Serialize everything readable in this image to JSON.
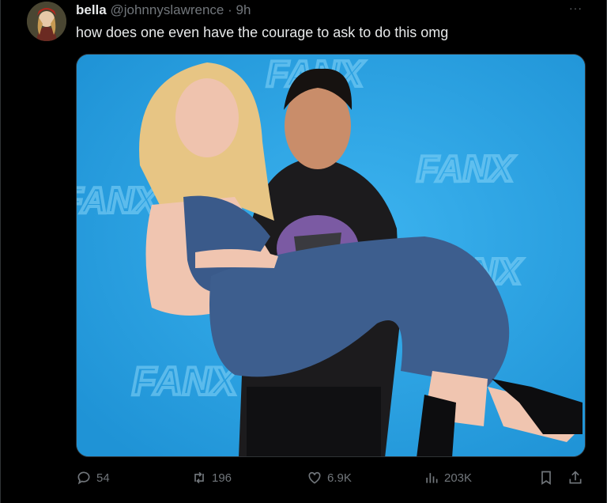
{
  "tweet": {
    "display_name": "bella",
    "handle": "@johnnyslawrence",
    "separator": "·",
    "time": "9h",
    "more_label": "···",
    "text": "how does one even have the courage to ask to do this omg"
  },
  "media": {
    "backdrop_logo_text": "FANX",
    "backdrop_color": "#2aa6e6",
    "icon": "photo-image"
  },
  "actions": {
    "replies": "54",
    "reposts": "196",
    "likes": "6.9K",
    "views": "203K"
  },
  "icons": [
    "reply-icon",
    "repost-icon",
    "like-icon",
    "views-icon",
    "bookmark-icon",
    "share-icon",
    "more-icon"
  ],
  "colors": {
    "background": "#000000",
    "text": "#e7e9ea",
    "muted": "#71767b",
    "border": "#2f3336"
  }
}
